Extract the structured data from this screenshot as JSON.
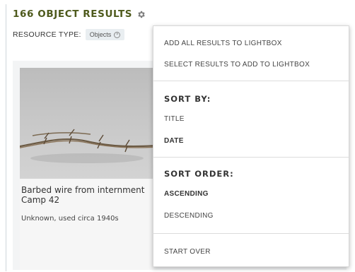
{
  "header": {
    "results_title": "166 OBJECT RESULTS",
    "settings_icon": "gear-icon"
  },
  "filters": {
    "label": "RESOURCE TYPE:",
    "pill_label": "Objects",
    "pill_remove_icon": "close-circle-icon"
  },
  "result_card": {
    "title": "Barbed wire from internment\nCamp 42",
    "subtitle": "Unknown, used circa 1940s"
  },
  "menu": {
    "add_all": "ADD ALL RESULTS TO LIGHTBOX",
    "select_results": "SELECT RESULTS TO ADD TO LIGHTBOX",
    "sort_by_heading": "SORT BY:",
    "sort_title": "TITLE",
    "sort_date": "DATE",
    "sort_order_heading": "SORT ORDER:",
    "ascending": "ASCENDING",
    "descending": "DESCENDING",
    "start_over": "START OVER"
  },
  "colors": {
    "title_olive": "#4e5a1c",
    "pill_bg": "#e9eef1",
    "card_bg": "#f6f6f6"
  }
}
